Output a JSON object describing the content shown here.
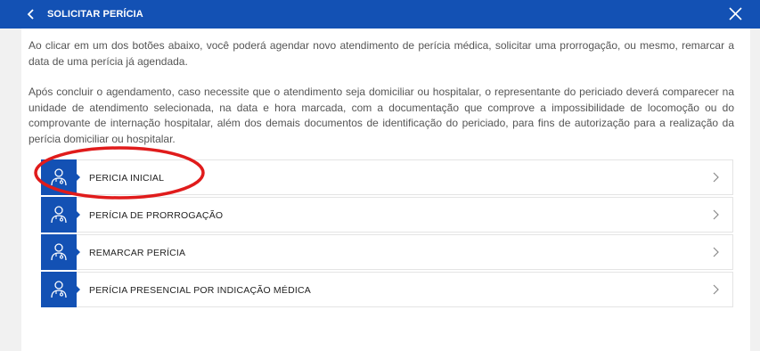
{
  "header": {
    "title": "SOLICITAR PERÍCIA",
    "back_icon": "chevron-left-icon",
    "close_icon": "close-icon",
    "background": "#1351b4"
  },
  "intro": {
    "paragraph_1": "Ao clicar em um dos botões abaixo, você poderá agendar novo atendimento de perícia médica, solicitar uma prorrogação, ou mesmo, remarcar a data de uma perícia já agendada.",
    "paragraph_2": "Após concluir o agendamento, caso necessite que o atendimento seja domiciliar ou hospitalar, o representante do periciado deverá comparecer na unidade de atendimento selecionada, na data e hora marcada, com a documentação que comprove a impossibilidade de locomoção ou do comprovante de internação hospitalar, além dos demais documentos de identificação do periciado, para fins de autorização para a realização da perícia domiciliar ou hospitalar."
  },
  "menu": {
    "items": [
      {
        "label": "PERICIA INICIAL",
        "icon": "doctor-icon"
      },
      {
        "label": "PERÍCIA DE PRORROGAÇÃO",
        "icon": "doctor-icon"
      },
      {
        "label": "REMARCAR PERÍCIA",
        "icon": "doctor-icon"
      },
      {
        "label": "PERÍCIA PRESENCIAL POR INDICAÇÃO MÉDICA",
        "icon": "doctor-icon"
      }
    ],
    "icon_background": "#1351b4",
    "chevron_icon": "chevron-right-icon"
  },
  "annotation": {
    "shape": "ellipse",
    "color": "#e01b1b"
  }
}
